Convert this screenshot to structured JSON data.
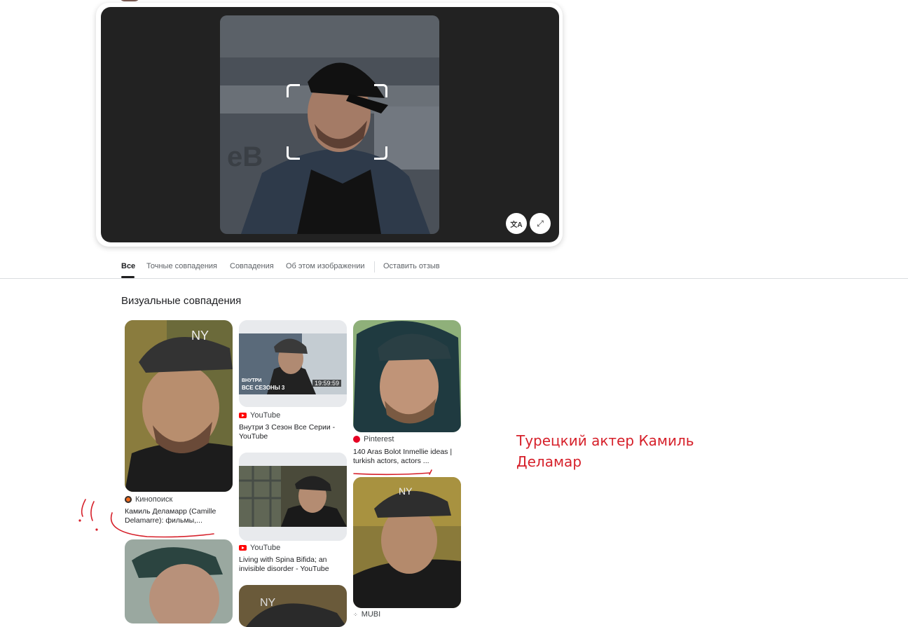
{
  "lens_panel": {
    "translate_icon": "translate-icon",
    "expand_icon": "expand-icon"
  },
  "tabs": [
    {
      "label": "Все",
      "active": true
    },
    {
      "label": "Точные совпадения"
    },
    {
      "label": "Совпадения"
    },
    {
      "label": "Об этом изображении"
    },
    {
      "label": "Оставить отзыв"
    }
  ],
  "section_title": "Визуальные совпадения",
  "results": [
    {
      "source": "Кинопоиск",
      "title": "Камиль Деламарр (Camille Delamarre): фильмы,..."
    },
    {
      "source": "YouTube",
      "title": "Внутри 3 Сезон Все Серии - YouTube",
      "thumb_text_1": "ВНУТРИ",
      "thumb_text_2": "ВСЕ СЕЗОНЫ 3",
      "duration": "19:59:59"
    },
    {
      "source": "Pinterest",
      "title": "140 Aras Bolot Inmellie ideas | turkish actors, actors ..."
    },
    {
      "source": "YouTube",
      "title": "Living with Spina Bifida; an invisible disorder - YouTube"
    },
    {
      "source": "MUBI",
      "title": ""
    }
  ],
  "annotation": "Турецкий актер Камиль Деламар",
  "colors": {
    "annotation": "#d6202a",
    "youtube": "#ff0000",
    "pinterest": "#e60023"
  }
}
